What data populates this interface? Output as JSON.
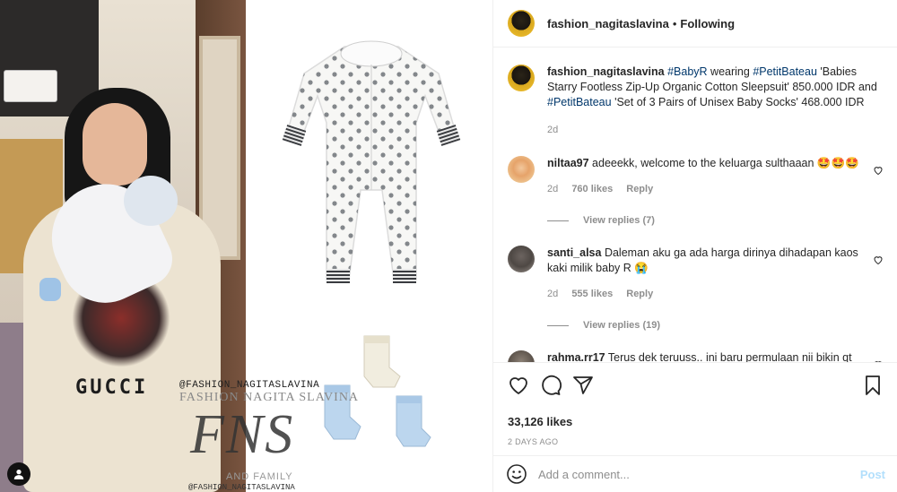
{
  "post_image": {
    "jacket_text": "GUCCI",
    "watermark_top": "@FASHION_NAGITASLAVINA",
    "watermark_name": "FASHION NAGITA SLAVINA",
    "watermark_logo": "FNS",
    "watermark_family": "AND FAMILY",
    "watermark_bottom": "@FASHION_NAGITASLAVINA"
  },
  "header": {
    "username": "fashion_nagitaslavina",
    "separator": "•",
    "follow_status": "Following"
  },
  "caption": {
    "username": "fashion_nagitaslavina",
    "tag1": "#BabyR",
    "text1": " wearing ",
    "tag2": "#PetitBateau",
    "text2": " 'Babies Starry Footless Zip-Up Organic Cotton Sleepsuit' 850.000 IDR and ",
    "tag3": "#PetitBateau",
    "text3": " 'Set of 3 Pairs of Unisex Baby Socks' 468.000 IDR",
    "time": "2d"
  },
  "comments": [
    {
      "username": "niltaa97",
      "text": "adeeekk, welcome to the keluarga sulthaaan 🤩🤩🤩",
      "time": "2d",
      "likes": "760 likes",
      "reply": "Reply",
      "view_replies": "View replies (7)"
    },
    {
      "username": "santi_alsa",
      "text": "Daleman aku ga ada harga dirinya dihadapan kaos kaki milik baby R 😭",
      "time": "2d",
      "likes": "555 likes",
      "reply": "Reply",
      "view_replies": "View replies (19)"
    },
    {
      "username": "rahma.rr17",
      "text": "Terus dek teruuss.. ini baru permulaan nii bikin qt"
    }
  ],
  "actions": {
    "likes": "33,126 likes",
    "posted_ago": "2 DAYS AGO"
  },
  "add_comment": {
    "placeholder": "Add a comment...",
    "post_label": "Post"
  }
}
